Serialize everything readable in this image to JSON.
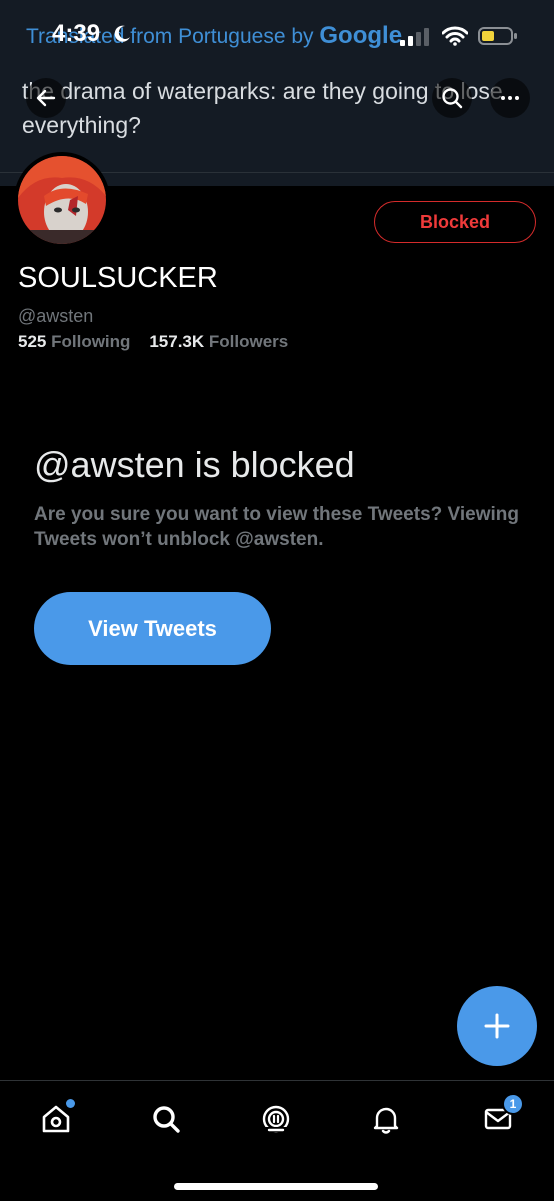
{
  "status_bar": {
    "time": "4:39"
  },
  "translation_banner": {
    "prefix": "Translated from Portuguese by",
    "brand": "Google"
  },
  "header": {
    "headline": "the drama of waterparks: are they going to lose everything?"
  },
  "profile": {
    "display_name": "SOULSUCKER",
    "handle": "@awsten",
    "following_count": "525",
    "following_label": "Following",
    "followers_count": "157.3K",
    "followers_label": "Followers",
    "blocked_button": "Blocked"
  },
  "blocked_notice": {
    "title": "@awsten is blocked",
    "description": "Are you sure you want to view these Tweets? Viewing Tweets won’t unblock @awsten.",
    "view_button": "View Tweets"
  },
  "tab_bar": {
    "items": [
      "home-icon",
      "search-icon",
      "spaces-icon",
      "notifications-icon",
      "messages-icon"
    ],
    "messages_badge": "1"
  },
  "colors": {
    "accent": "#4a99e9",
    "blocked_red": "#ef3a3a",
    "muted_text": "#71767b"
  }
}
